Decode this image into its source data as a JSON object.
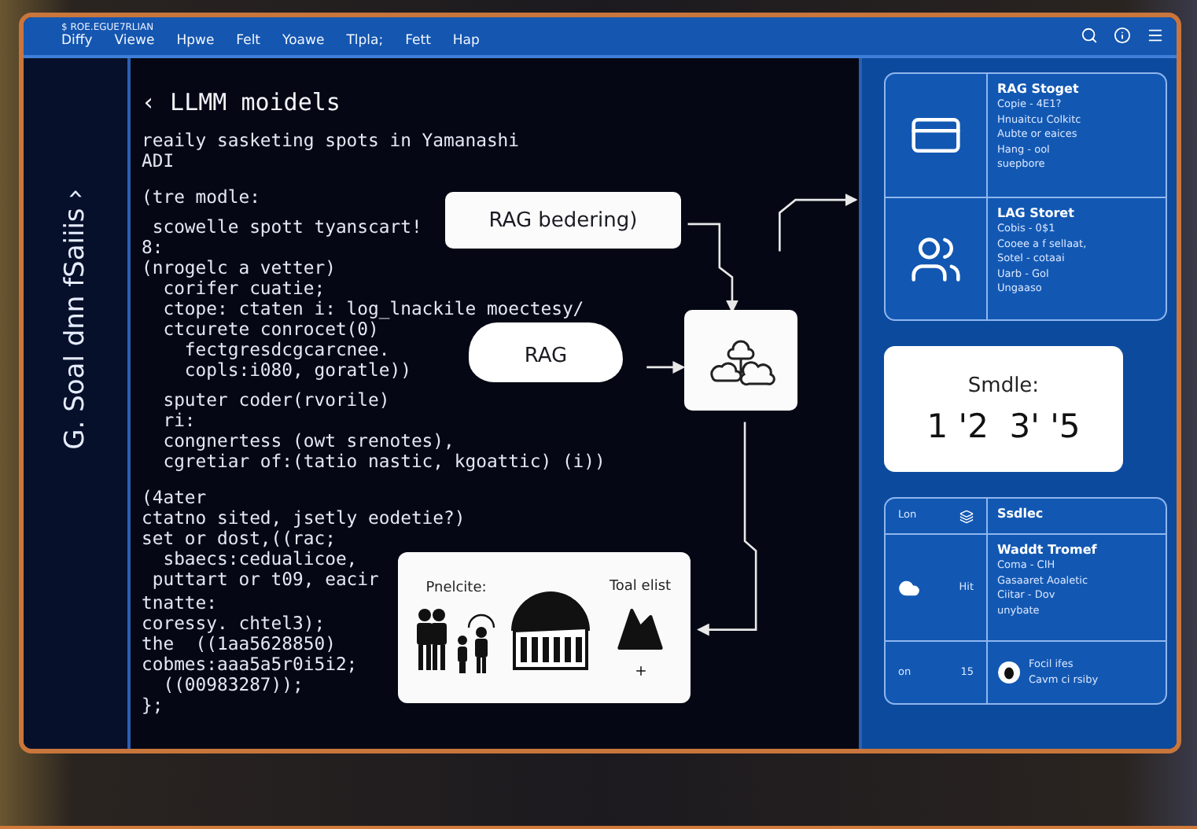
{
  "menu_bar": {
    "caption": "$ ROE.EGUE7RLIAN",
    "items": [
      "Diffy",
      "Viewe",
      "Hpwe",
      "Felt",
      "Yoawe",
      "Tlpla;",
      "Fett",
      "Hap"
    ]
  },
  "sidebar": {
    "title": "G. Soal dnn fSaiiis ›"
  },
  "editor": {
    "heading": "‹ LLMM moidels",
    "blocks": [
      [
        "reaily sasketing spots in Yamanashi",
        "ADI"
      ],
      [
        "(tre modle:"
      ],
      [
        " scowelle spott tyanscart!",
        "8:",
        "(nrogelc a vetter)",
        "  corifer cuatie;",
        "  ctope: ctaten i: log_lnackile moectesy/",
        "  ctcurete conrocet(0)",
        "    fectgresdcgcarcnee.",
        "    copls:i080, goratle))"
      ],
      [
        "  sputer coder(rvorile)",
        "  ri:",
        "  congnertess (owt srenotes),",
        "  cgretiar of:(tatio nastic, kgoattic) (i))"
      ],
      [
        "(4ater",
        "ctatno sited, jsetly eodetie?)",
        "set or dost,((rac;",
        "  sbaecs:cedualicoe,",
        " puttart or t09, eacir"
      ],
      [
        "tnatte:",
        "coressy. chtel3);",
        "the  ((1aa5628850)",
        "cobmes:aaa5a5r0i5i2;",
        "  ((00983287));",
        "};"
      ]
    ]
  },
  "diagram": {
    "rag_box": "RAG bedering)",
    "rag_cloud": "RAG",
    "output_card": {
      "left_label": "Pnelcite:",
      "right_label": "Toal elist"
    }
  },
  "panel": {
    "source_card": {
      "rows": [
        {
          "title": "RAG Stoget",
          "lines": [
            "Copie - 4E1?",
            "Hnuaitcu Colkitc",
            "Aubte or eaices",
            "Hang - ool",
            "suepbore"
          ]
        },
        {
          "title": "LAG Storet",
          "lines": [
            "Cobis - 0$1",
            "Cooee a f selIaat,",
            "Sotel - cotaai",
            "Uarb - Gol",
            "Ungaaso"
          ]
        }
      ]
    },
    "score_card": {
      "label": "Smdle:",
      "value": "1 '2  3' '5"
    },
    "table": {
      "header": [
        "Lon",
        "Ssdlec"
      ],
      "rows": [
        {
          "code": "Hit",
          "title": "Waddt Tromef",
          "lines": [
            "Coma - CIH",
            "Gasaaret Aoaletic",
            "Ciitar - Dov",
            "unybate"
          ]
        },
        {
          "label": "on",
          "code": "15",
          "lines": [
            "Focil ifes",
            "Cavm ci rsiby"
          ]
        }
      ]
    }
  }
}
